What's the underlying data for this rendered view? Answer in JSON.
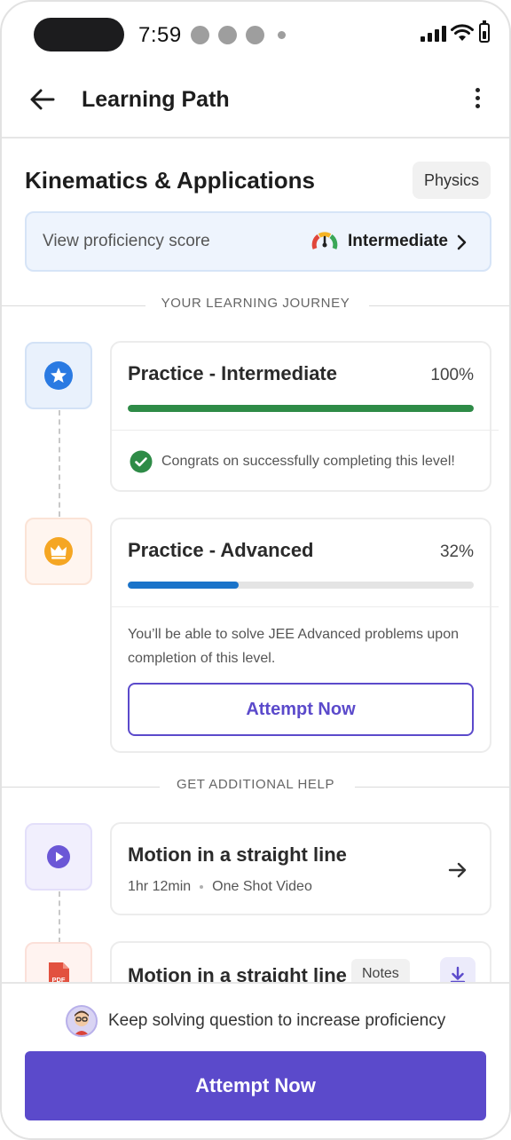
{
  "status_bar": {
    "time": "7:59"
  },
  "app_bar": {
    "title": "Learning Path"
  },
  "topic": {
    "title": "Kinematics & Applications",
    "subject": "Physics"
  },
  "proficiency": {
    "label": "View proficiency score",
    "level": "Intermediate"
  },
  "journey": {
    "heading": "YOUR LEARNING JOURNEY",
    "levels": [
      {
        "title": "Practice - Intermediate",
        "percent_label": "100%",
        "progress": 1.0,
        "status_text": "Congrats on successfully completing this level!",
        "icon": "star-icon",
        "bar_color": "#2e8b47"
      },
      {
        "title": "Practice - Advanced",
        "percent_label": "32%",
        "progress": 0.32,
        "description": "You’ll be able to solve JEE Advanced problems upon completion of this level.",
        "button_label": "Attempt Now",
        "icon": "crown-icon",
        "bar_color": "#1a73c9"
      }
    ]
  },
  "help": {
    "heading": "GET ADDITIONAL HELP",
    "items": [
      {
        "title": "Motion in a straight line",
        "duration": "1hr 12min",
        "type": "One Shot Video",
        "icon": "play-icon"
      },
      {
        "title": "Motion in a straight line",
        "badge": "Notes",
        "icon": "pdf-icon"
      }
    ]
  },
  "bottom": {
    "hint": "Keep solving question to increase proficiency",
    "cta_label": "Attempt Now"
  },
  "colors": {
    "accent": "#5b4acb",
    "success": "#2e8b47",
    "progress_blue": "#1a73c9",
    "star_blue": "#2a7ae2",
    "crown_orange": "#f5a623"
  }
}
